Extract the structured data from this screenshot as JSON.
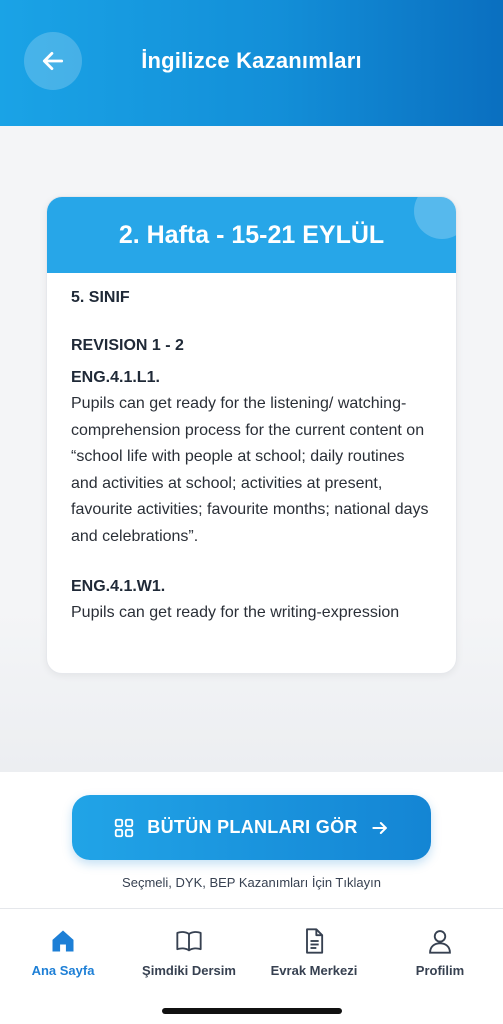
{
  "header": {
    "title": "İngilizce Kazanımları"
  },
  "card": {
    "week_title": "2. Hafta - 15-21 EYLÜL",
    "class_label": "5. SINIF",
    "unit_label": "REVISION 1 - 2",
    "outcomes": [
      {
        "code": "ENG.4.1.L1.",
        "text": "Pupils can get ready for the listening/ watching-comprehension process for the current content on “school life with people at school; daily routines and activities at school; activities at present, favourite activities; favourite months; national days and celebrations”."
      },
      {
        "code": "ENG.4.1.W1.",
        "text": "Pupils can get ready for the writing-expression"
      }
    ]
  },
  "actions": {
    "all_plans_label": "BÜTÜN PLANLARI GÖR",
    "hint": "Seçmeli, DYK, BEP Kazanımları İçin Tıklayın"
  },
  "tabs": [
    {
      "label": "Ana Sayfa",
      "icon": "home-icon",
      "active": true
    },
    {
      "label": "Şimdiki Dersim",
      "icon": "book-icon",
      "active": false
    },
    {
      "label": "Evrak Merkezi",
      "icon": "document-icon",
      "active": false
    },
    {
      "label": "Profilim",
      "icon": "user-icon",
      "active": false
    }
  ],
  "colors": {
    "primary": "#1a9be3",
    "active_tab": "#1d7fd6"
  }
}
